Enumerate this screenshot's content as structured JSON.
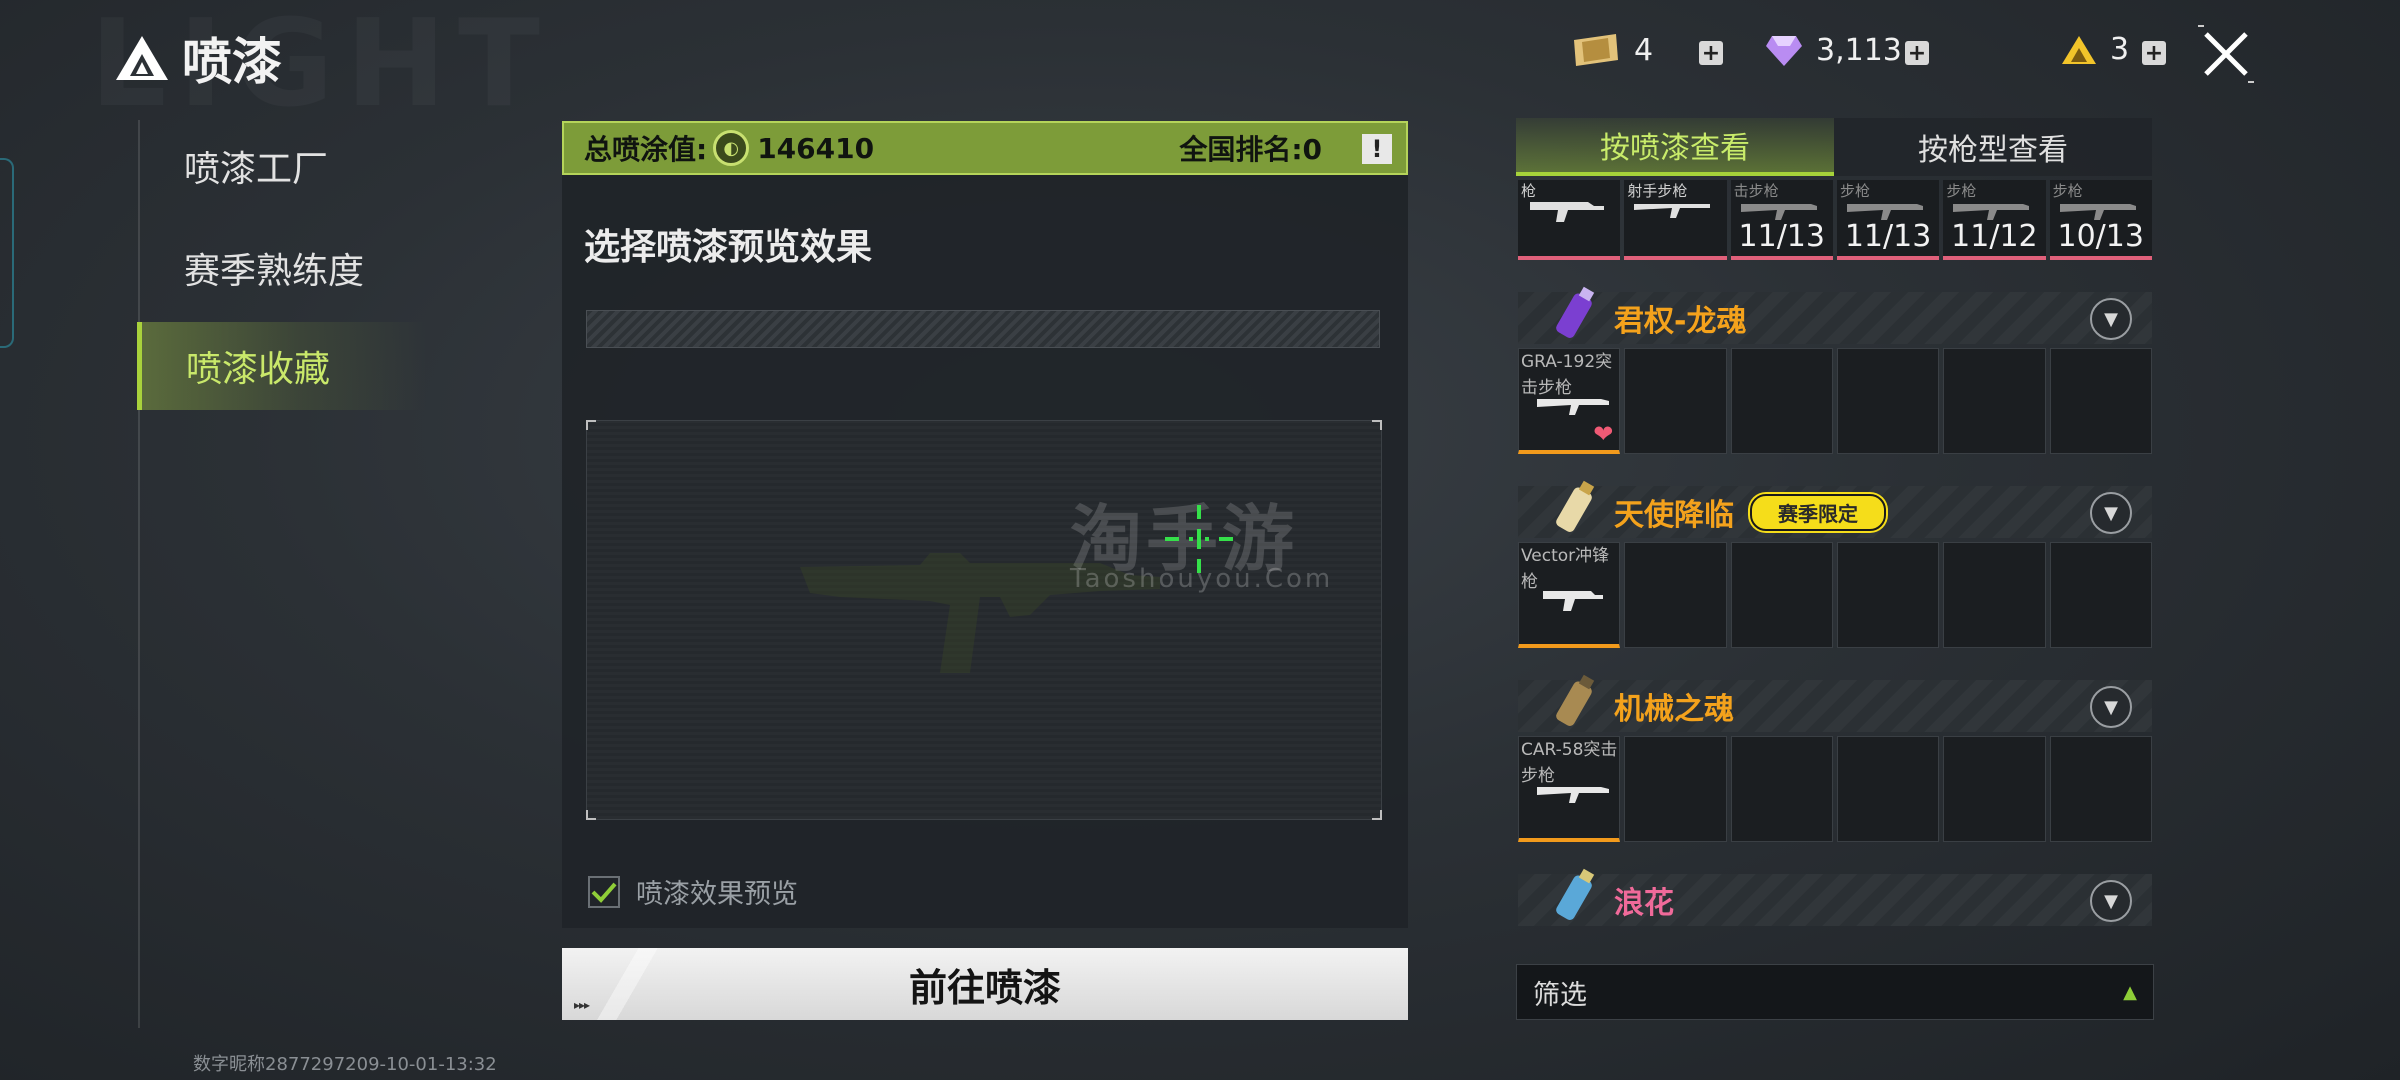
{
  "app": {
    "title": "喷漆",
    "background_watermark": "LIGHT"
  },
  "colors": {
    "accent_green": "#a9d23c",
    "score_bar": "#7d9c39",
    "spray_name_orange": "#f4a21c",
    "spray_name_pink": "#f06a9a",
    "season_badge": "#f5dd1a"
  },
  "currencies": [
    {
      "icon": "ticket-icon",
      "value": "4"
    },
    {
      "icon": "diamond-icon",
      "value": "3,113"
    },
    {
      "icon": "triangle-token-icon",
      "value": "3"
    }
  ],
  "sidebar": {
    "items": [
      {
        "label": "喷漆工厂",
        "active": false
      },
      {
        "label": "赛季熟练度",
        "active": false
      },
      {
        "label": "喷漆收藏",
        "active": true
      }
    ]
  },
  "score": {
    "label": "总喷涂值:",
    "value": "146410",
    "rank": "全国排名:0",
    "info_icon": "!"
  },
  "preview": {
    "title": "选择喷漆预览效果",
    "watermark_cn": "淘手游",
    "watermark_en": "Taoshouyou.Com",
    "checkbox_label": "喷漆效果预览",
    "checkbox_checked": true,
    "goto_button": "前往喷漆",
    "button_arrows": "▸▸▸"
  },
  "tabs": [
    {
      "label": "按喷漆查看",
      "active": true
    },
    {
      "label": "按枪型查看",
      "active": false
    }
  ],
  "weapon_strip": [
    {
      "name": "枪",
      "count": ""
    },
    {
      "name": "射手步枪",
      "count": ""
    },
    {
      "name": "击步枪",
      "count": "11/13"
    },
    {
      "name": "步枪",
      "count": "11/13"
    },
    {
      "name": "步枪",
      "count": "11/12"
    },
    {
      "name": "步枪",
      "count": "10/13"
    }
  ],
  "sprays": [
    {
      "name": "君权-龙魂",
      "badge": "",
      "color": "orange",
      "first_slot_weapon": "GRA-192突击步枪",
      "favorited": true
    },
    {
      "name": "天使降临",
      "badge": "赛季限定",
      "color": "orange",
      "first_slot_weapon": "Vector冲锋枪",
      "favorited": false
    },
    {
      "name": "机械之魂",
      "badge": "",
      "color": "orange",
      "first_slot_weapon": "CAR-58突击步枪",
      "favorited": false
    },
    {
      "name": "浪花",
      "badge": "",
      "color": "pink",
      "first_slot_weapon": "",
      "favorited": false
    }
  ],
  "filter": {
    "label": "筛选",
    "arrow": "▲"
  },
  "footer": {
    "player_id": "数字昵称2877297209-10-01-13:32"
  }
}
